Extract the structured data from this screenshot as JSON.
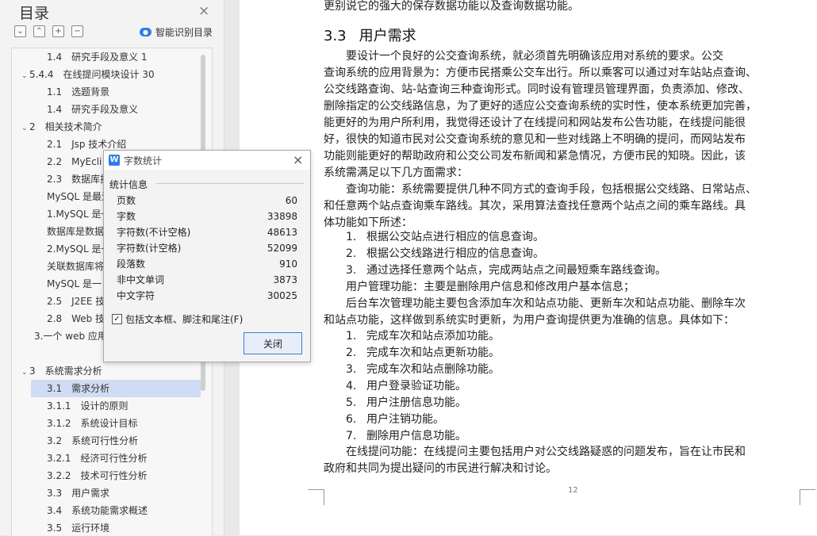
{
  "sidebar": {
    "title": "目录",
    "close_icon": "×",
    "tools": [
      "⌄",
      "⌃",
      "+",
      "−"
    ],
    "smart_toc_label": "智能识别目录",
    "toc": [
      {
        "label": "1.4　研究手段及意义 1",
        "arrow": ""
      },
      {
        "label": "5.4.4　在线提问模块设计 30",
        "arrow": "⌄"
      },
      {
        "label": "1.1　选题背景",
        "arrow": ""
      },
      {
        "label": "1.4　研究手段及意义",
        "arrow": ""
      },
      {
        "label": "2　相关技术简介",
        "arrow": "⌄"
      },
      {
        "label": "2.1　Jsp 技术介绍",
        "arrow": ""
      },
      {
        "label": "2.2　MyEcli",
        "arrow": ""
      },
      {
        "label": "2.3　数据库技",
        "arrow": ""
      },
      {
        "label": "MySQL 是最流",
        "arrow": ""
      },
      {
        "label": "1.MySQL 是一",
        "arrow": ""
      },
      {
        "label": "数据库是数据",
        "arrow": ""
      },
      {
        "label": "2.MySQL 是一",
        "arrow": ""
      },
      {
        "label": "关联数据库将",
        "arrow": ""
      },
      {
        "label": "MySQL 是一",
        "arrow": ""
      },
      {
        "label": "2.5　J2EE 技",
        "arrow": ""
      },
      {
        "label": "2.8　Web 技",
        "arrow": ""
      },
      {
        "label": "3.一个 web 应用",
        "arrow": ""
      },
      {
        "label": "",
        "arrow": ""
      },
      {
        "label": "3　系统需求分析",
        "arrow": "⌄"
      },
      {
        "label": "3.1　需求分析",
        "arrow": ""
      },
      {
        "label": "3.1.1　设计的原则",
        "arrow": ""
      },
      {
        "label": "3.1.2　系统设计目标",
        "arrow": ""
      },
      {
        "label": "3.2　系统可行性分析",
        "arrow": ""
      },
      {
        "label": "3.2.1　经济可行性分析",
        "arrow": ""
      },
      {
        "label": "3.2.2　技术可行性分析",
        "arrow": ""
      },
      {
        "label": "3.3　用户需求",
        "arrow": ""
      },
      {
        "label": "3.4　系统功能需求概述",
        "arrow": ""
      },
      {
        "label": "3.5　运行环境",
        "arrow": ""
      }
    ]
  },
  "document": {
    "top_line": "更别说它的强大的保存数据功能以及查询数据功能。",
    "heading_num": "3.3",
    "heading_text": "用户需求",
    "para1": [
      "　　要设计一个良好的公交查询系统，就必须首先明确该应用对系统的要求。公交",
      "查询系统的应用背景为：方便市民搭乘公交车出行。所以乘客可以通过对车站站点查询、",
      "公交线路查询、站-站查询三种查询形式。同时设有管理员管理界面，负责添加、修改、",
      "删除指定的公交线路信息，为了更好的适应公交查询系统的实时性，使本系统更加完善，",
      "能更好的为用户所利用，我觉得还设计了在线提问和网站发布公告功能，在线提问能很",
      "好，很快的知道市民对公交查询系统的意见和一些对线路上不明确的提问，而网站发布",
      "功能则能更好的帮助政府和公交公司发布新闻和紧急情况，方便市民的知晓。因此，该",
      "系统需满足以下几方面需求："
    ],
    "para2": [
      "　　查询功能：系统需要提供几种不同方式的查询手段，包括根据公交线路、日常站点、",
      "和任意两个站点查询乘车路线。其次，采用算法查找任意两个站点之间的乘车路线。具",
      "体功能如下所述："
    ],
    "list1": [
      {
        "n": "1.",
        "t": "根据公交站点进行相应的信息查询。"
      },
      {
        "n": "2.",
        "t": "根据公交线路进行相应的信息查询。"
      },
      {
        "n": "3.",
        "t": "通过选择任意两个站点，完成两站点之间最短乘车路线查询。"
      }
    ],
    "para3": "　　用户管理功能：主要是删除用户信息和修改用户基本信息；",
    "para4": [
      "　　后台车次管理功能主要包含添加车次和站点功能、更新车次和站点功能、删除车次",
      "和站点功能，这样做到系统实时更新，为用户查询提供更为准确的信息。具体如下："
    ],
    "list2": [
      {
        "n": "1.",
        "t": "完成车次和站点添加功能。"
      },
      {
        "n": "2.",
        "t": "完成车次和站点更新功能。"
      },
      {
        "n": "3.",
        "t": "完成车次和站点删除功能。"
      },
      {
        "n": "4.",
        "t": "用户登录验证功能。"
      },
      {
        "n": "5.",
        "t": "用户注册信息功能。"
      },
      {
        "n": "6.",
        "t": "用户注销功能。"
      },
      {
        "n": "7.",
        "t": "删除用户信息功能。"
      }
    ],
    "para5": [
      "　　在线提问功能：在线提问主要包括用户对公交线路疑惑的问题发布，旨在让市民和",
      "政府和共同为提出疑问的市民进行解决和讨论。"
    ],
    "page_number": "12"
  },
  "dialog": {
    "icon": "W",
    "title": "字数统计",
    "close_icon": "×",
    "section": "统计信息",
    "stats": [
      {
        "label": "页数",
        "value": "60"
      },
      {
        "label": "字数",
        "value": "33898"
      },
      {
        "label": "字符数(不计空格)",
        "value": "48613"
      },
      {
        "label": "字符数(计空格)",
        "value": "52099"
      },
      {
        "label": "段落数",
        "value": "910"
      },
      {
        "label": "非中文单词",
        "value": "3873"
      },
      {
        "label": "中文字符",
        "value": "30025"
      }
    ],
    "checkbox_label": "包括文本框、脚注和尾注(F)",
    "checkbox_mark": "✓",
    "close_button": "关闭"
  }
}
